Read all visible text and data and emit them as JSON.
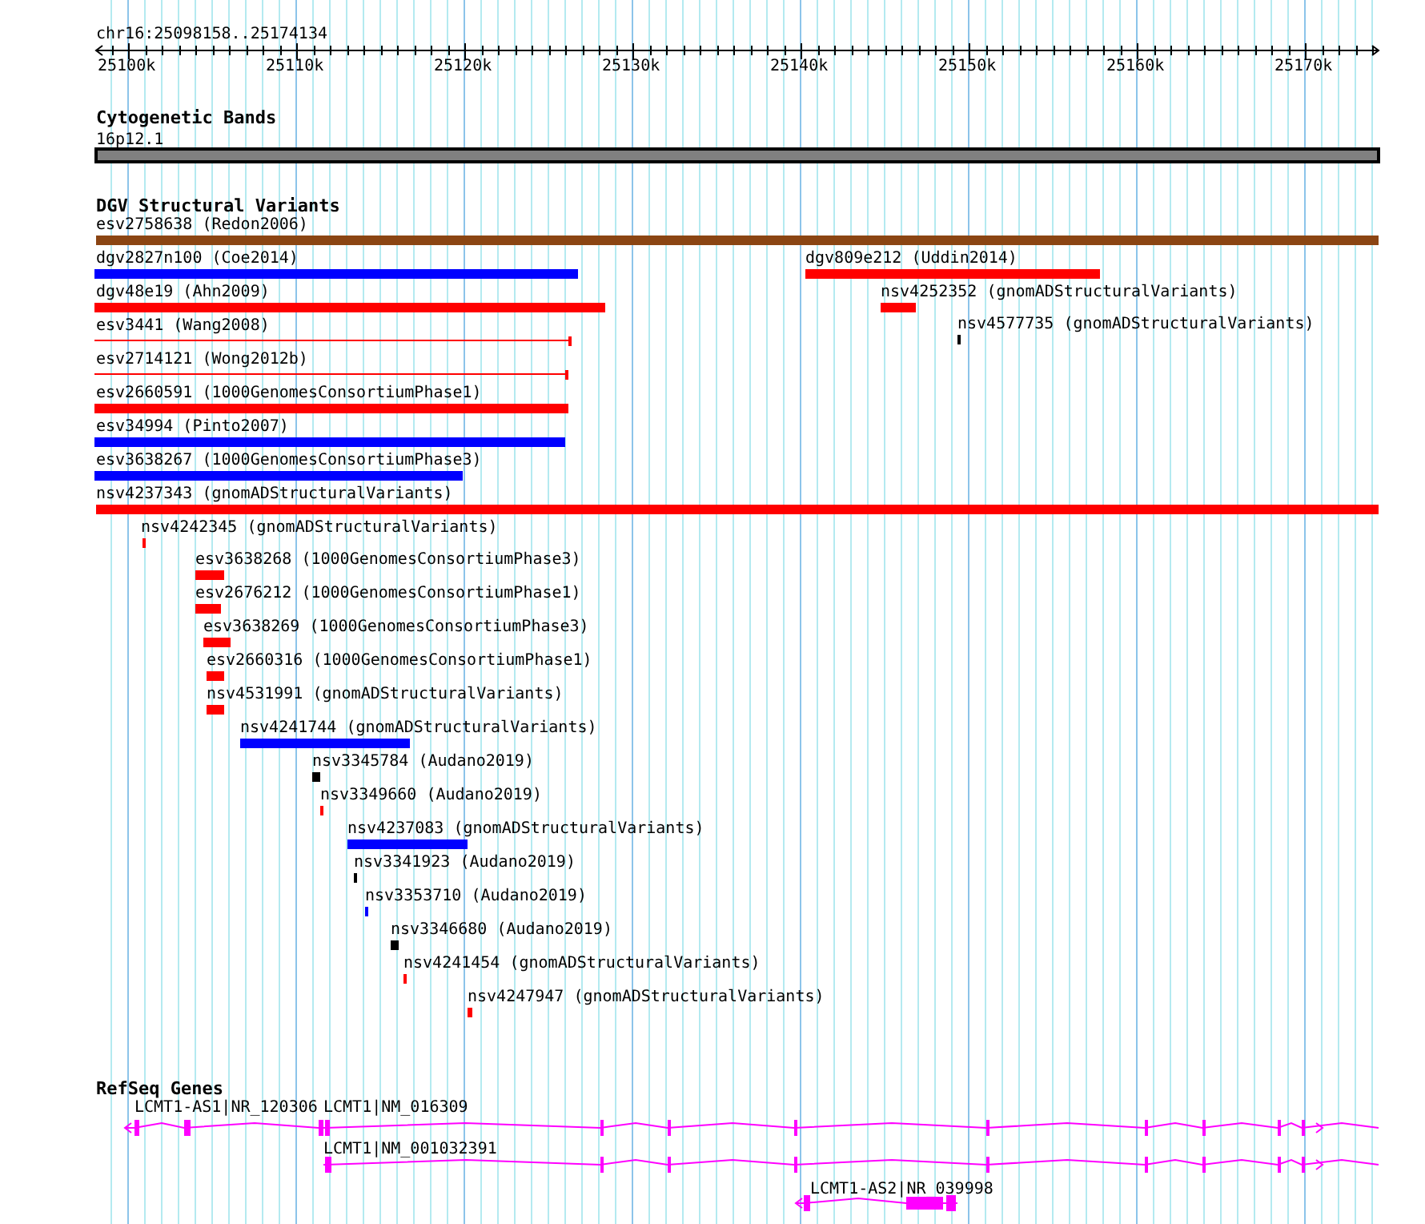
{
  "location": "chr16:25098158..25174134",
  "ruler": {
    "ticks": [
      "25100k",
      "25110k",
      "25120k",
      "25130k",
      "25140k",
      "25150k",
      "25160k",
      "25170k"
    ]
  },
  "tracks": [
    {
      "kind": "bands",
      "title": "Cytogenetic Bands",
      "features": [
        {
          "label": "16p12.1",
          "kind": "bar",
          "color": "#808080"
        }
      ]
    },
    {
      "kind": "variants",
      "title": "DGV Structural Variants",
      "features": [
        {
          "label": "esv2758638 (Redon2006)",
          "kind": "bar",
          "color": "#8b4513"
        },
        {
          "label": "dgv2827n100 (Coe2014)",
          "kind": "bar",
          "color": "#0000ff"
        },
        {
          "label": "dgv809e212 (Uddin2014)",
          "kind": "bar",
          "color": "#ff0000"
        },
        {
          "label": "dgv48e19 (Ahn2009)",
          "kind": "bar",
          "color": "#ff0000"
        },
        {
          "label": "nsv4252352 (gnomADStructuralVariants)",
          "kind": "bar",
          "color": "#ff0000"
        },
        {
          "label": "esv3441 (Wang2008)",
          "kind": "line",
          "color": "#ff0000"
        },
        {
          "label": "nsv4577735 (gnomADStructuralVariants)",
          "kind": "bar",
          "color": "#000000"
        },
        {
          "label": "esv2714121 (Wong2012b)",
          "kind": "line",
          "color": "#ff0000"
        },
        {
          "label": "esv2660591 (1000GenomesConsortiumPhase1)",
          "kind": "bar",
          "color": "#ff0000"
        },
        {
          "label": "esv34994 (Pinto2007)",
          "kind": "bar",
          "color": "#0000ff"
        },
        {
          "label": "esv3638267 (1000GenomesConsortiumPhase3)",
          "kind": "bar",
          "color": "#0000ff"
        },
        {
          "label": "nsv4237343 (gnomADStructuralVariants)",
          "kind": "bar",
          "color": "#ff0000"
        },
        {
          "label": "nsv4242345 (gnomADStructuralVariants)",
          "kind": "bar",
          "color": "#ff0000"
        },
        {
          "label": "esv3638268 (1000GenomesConsortiumPhase3)",
          "kind": "bar",
          "color": "#ff0000"
        },
        {
          "label": "esv2676212 (1000GenomesConsortiumPhase1)",
          "kind": "bar",
          "color": "#ff0000"
        },
        {
          "label": "esv3638269 (1000GenomesConsortiumPhase3)",
          "kind": "bar",
          "color": "#ff0000"
        },
        {
          "label": "esv2660316 (1000GenomesConsortiumPhase1)",
          "kind": "bar",
          "color": "#ff0000"
        },
        {
          "label": "nsv4531991 (gnomADStructuralVariants)",
          "kind": "bar",
          "color": "#ff0000"
        },
        {
          "label": "nsv4241744 (gnomADStructuralVariants)",
          "kind": "bar",
          "color": "#0000ff"
        },
        {
          "label": "nsv3345784 (Audano2019)",
          "kind": "bar",
          "color": "#000000"
        },
        {
          "label": "nsv3349660 (Audano2019)",
          "kind": "bar",
          "color": "#ff0000"
        },
        {
          "label": "nsv4237083 (gnomADStructuralVariants)",
          "kind": "bar",
          "color": "#0000ff"
        },
        {
          "label": "nsv3341923 (Audano2019)",
          "kind": "bar",
          "color": "#000000"
        },
        {
          "label": "nsv3353710 (Audano2019)",
          "kind": "bar",
          "color": "#0000ff"
        },
        {
          "label": "nsv3346680 (Audano2019)",
          "kind": "bar",
          "color": "#000000"
        },
        {
          "label": "nsv4241454 (gnomADStructuralVariants)",
          "kind": "bar",
          "color": "#ff0000"
        },
        {
          "label": "nsv4247947 (gnomADStructuralVariants)",
          "kind": "bar",
          "color": "#ff0000"
        }
      ]
    },
    {
      "kind": "genes",
      "title": "RefSeq Genes",
      "features": [
        {
          "label": "LCMT1-AS1|NR_120306",
          "reverse_strand": true
        },
        {
          "label": "LCMT1|NM_016309",
          "reverse_strand": false
        },
        {
          "label": "LCMT1|NM_001032391",
          "reverse_strand": false
        },
        {
          "label": "LCMT1-AS2|NR_039998",
          "reverse_strand": true
        }
      ]
    }
  ]
}
